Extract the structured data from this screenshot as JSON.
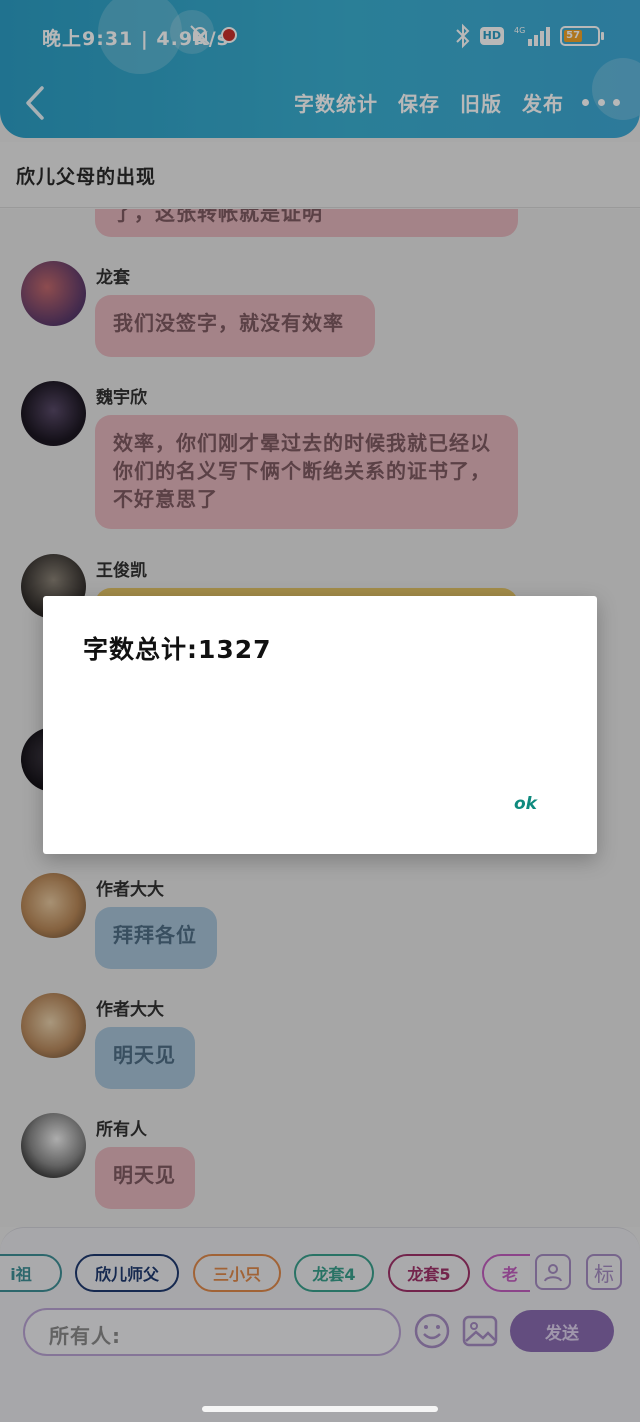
{
  "status_bar": {
    "left_text": "晚上9:31 | 4.9K/s",
    "network": "4G",
    "hd": "HD",
    "battery": "57"
  },
  "header": {
    "nav": [
      "字数统计",
      "保存",
      "旧版",
      "发布"
    ]
  },
  "page_title": "欣儿父母的出现",
  "messages": [
    {
      "sender": "",
      "text": "了，这张转帐就是证明",
      "color": "pink"
    },
    {
      "sender": "龙套",
      "text": "我们没签字，就没有效率",
      "color": "pink"
    },
    {
      "sender": "魏宇欣",
      "text": "效率，你们刚才晕过去的时候我就已经以你们的名义写下俩个断绝关系的证书了，不好意思了",
      "color": "pink"
    },
    {
      "sender": "王俊凯",
      "text": "",
      "color": "yellow"
    },
    {
      "sender": "作者大大",
      "text": "拜拜各位",
      "color": "blue"
    },
    {
      "sender": "作者大大",
      "text": "明天见",
      "color": "blue"
    },
    {
      "sender": "所有人",
      "text": "明天见",
      "color": "pink"
    }
  ],
  "chips": [
    {
      "label": "i祖",
      "color": "#3f8f96"
    },
    {
      "label": "欣儿师父",
      "color": "#1f3a6f"
    },
    {
      "label": "三小只",
      "color": "#e08a4c"
    },
    {
      "label": "龙套4",
      "color": "#3aa08d"
    },
    {
      "label": "龙套5",
      "color": "#a0336a"
    },
    {
      "label": "老",
      "color": "#c25fbf"
    }
  ],
  "side_buttons": {
    "person": "person-icon",
    "tag": "标"
  },
  "input": {
    "placeholder": "所有人:"
  },
  "send_label": "发送",
  "dialog": {
    "title": "字数总计:1327",
    "ok": "ok"
  }
}
